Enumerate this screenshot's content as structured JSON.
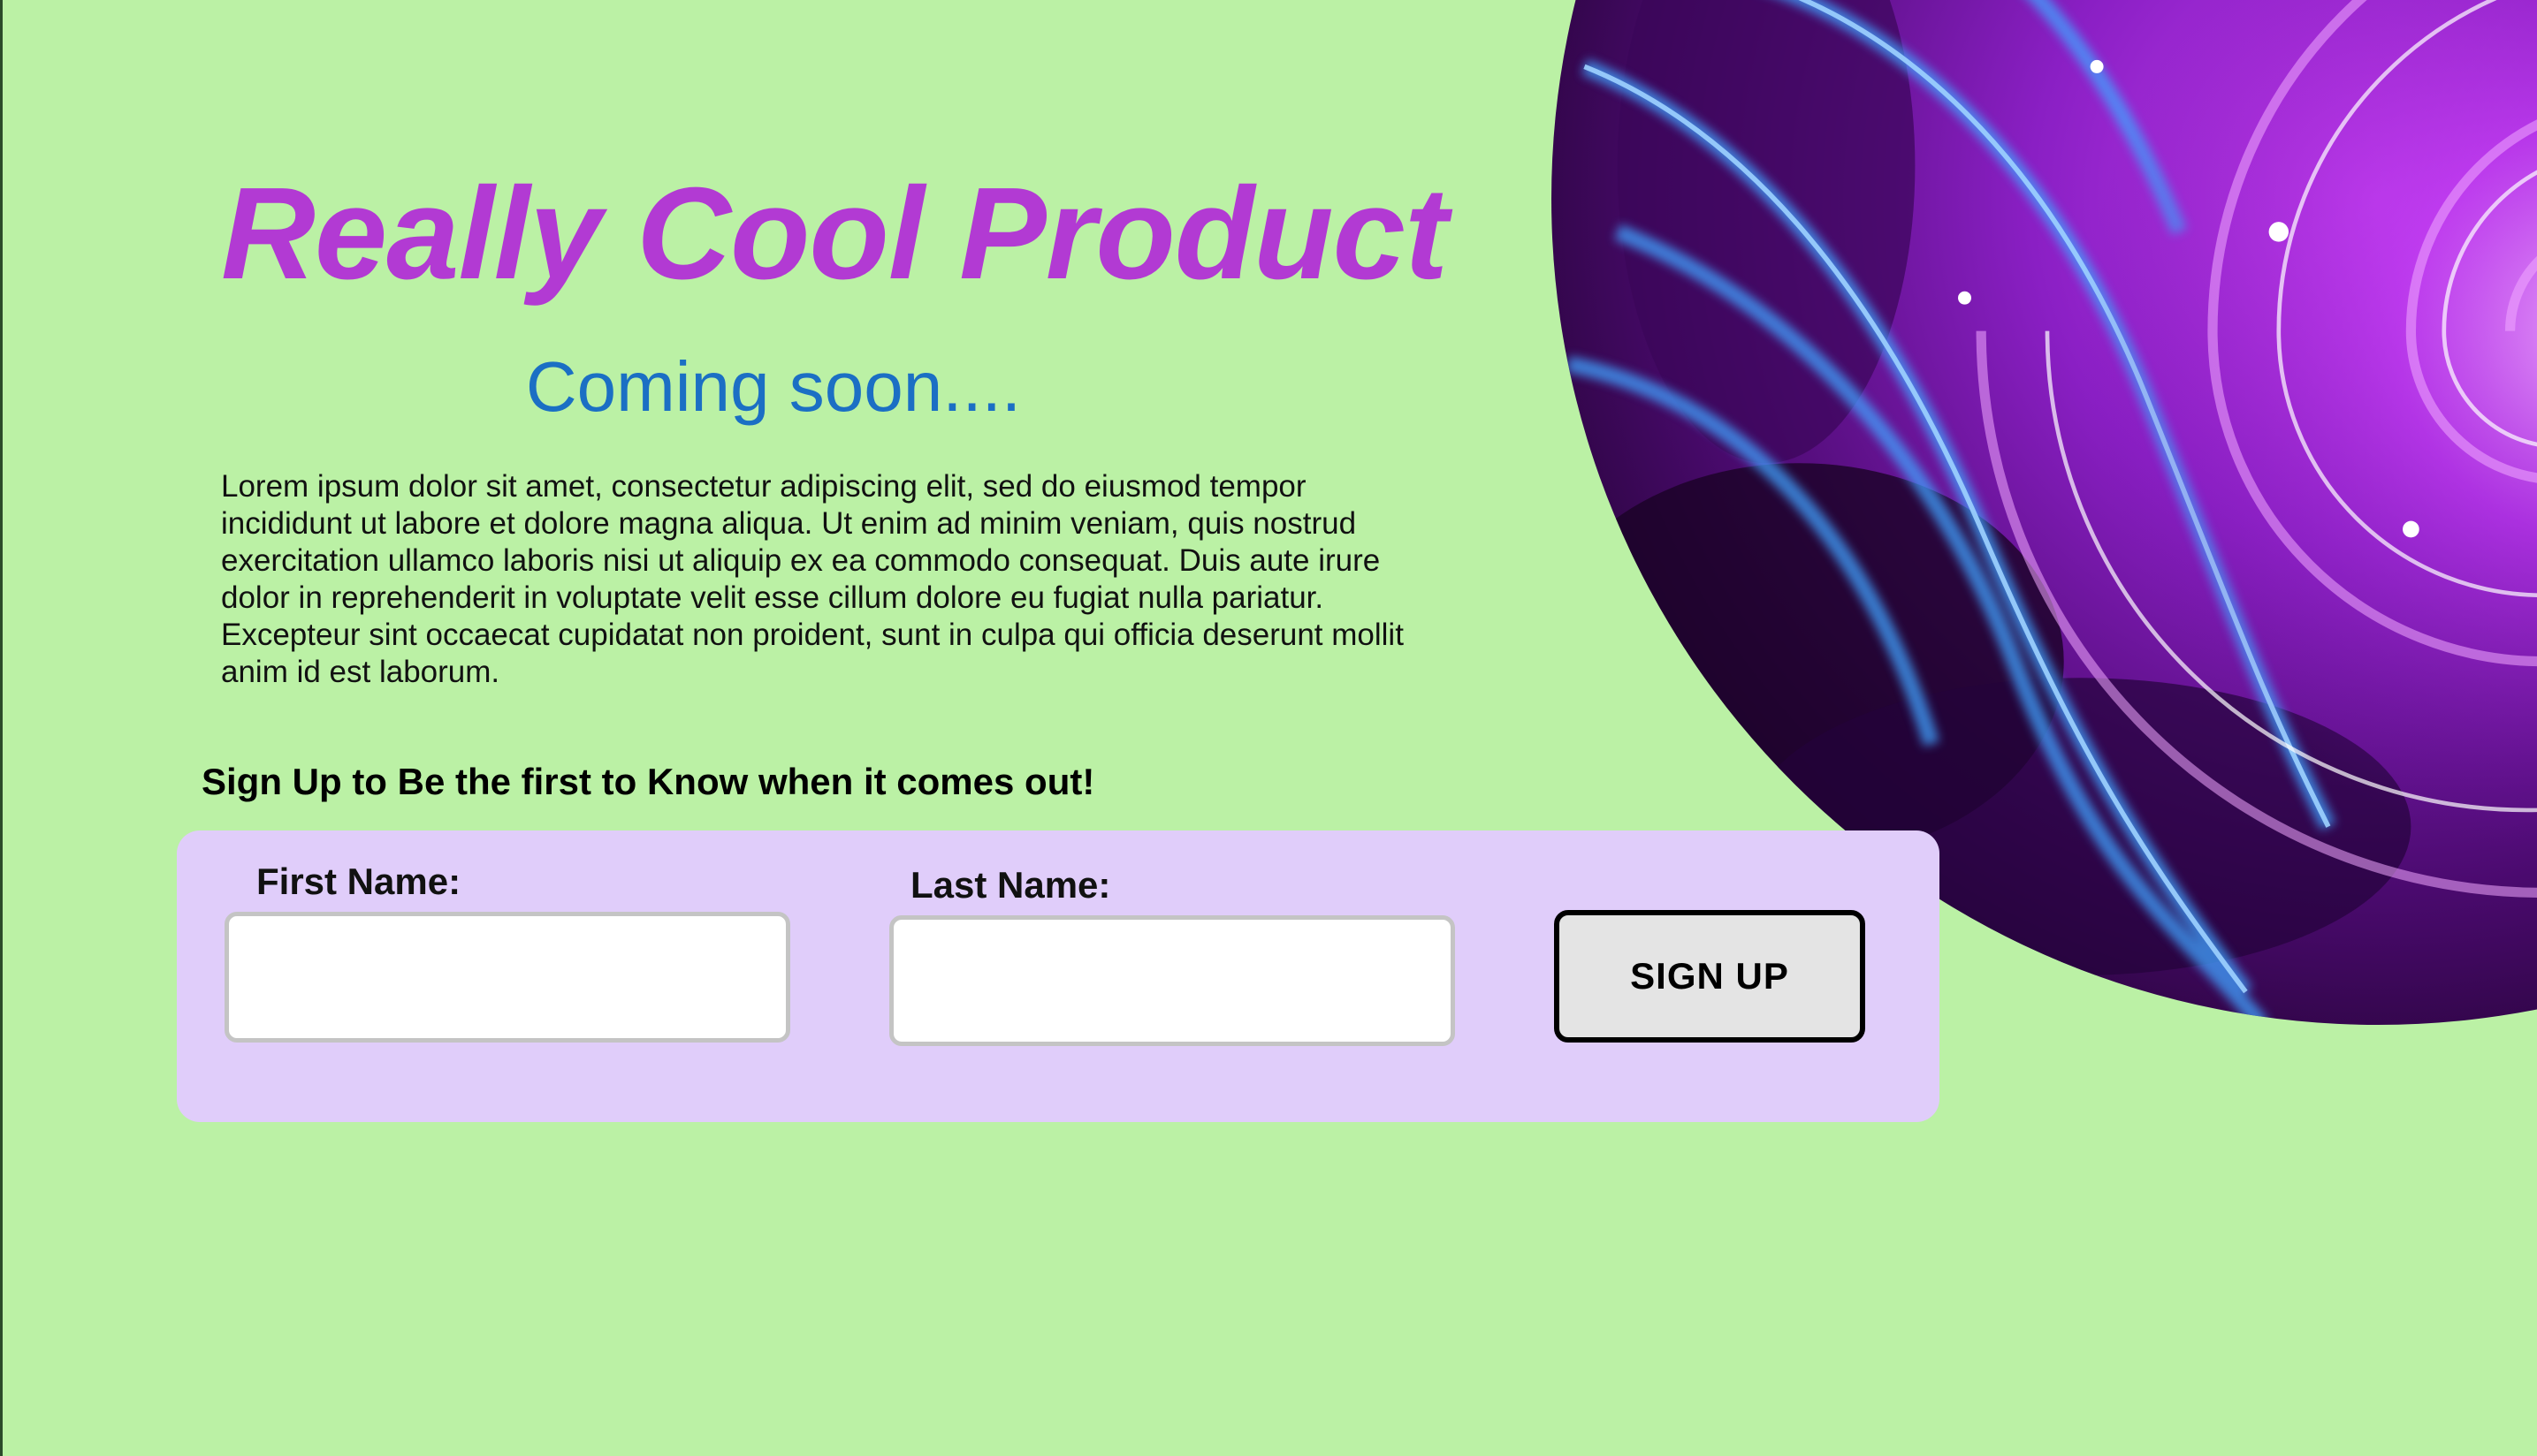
{
  "hero": {
    "title": "Really Cool Product",
    "subtitle": "Coming soon....",
    "description": "Lorem ipsum dolor sit amet, consectetur adipiscing elit, sed do eiusmod tempor incididunt ut labore et dolore magna aliqua. Ut enim ad minim veniam, quis nostrud exercitation ullamco laboris nisi ut aliquip ex ea commodo consequat. Duis aute irure dolor in reprehenderit in voluptate velit esse cillum dolore eu fugiat nulla pariatur. Excepteur sint occaecat cupidatat non proident, sunt in culpa qui officia deserunt mollit anim id est laborum."
  },
  "signup": {
    "heading": "Sign Up to Be the first to Know when it comes out!",
    "first_name_label": "First Name:",
    "last_name_label": "Last Name:",
    "first_name_value": "",
    "last_name_value": "",
    "button_label": "SIGN UP"
  },
  "colors": {
    "background": "#bbf1a5",
    "title": "#b23ad3",
    "subtitle": "#1b6fc4",
    "panel": "#e0cdfa",
    "button_bg": "#e4e4e4"
  },
  "icons": {
    "hero_image": "purple-swirl-artwork"
  }
}
